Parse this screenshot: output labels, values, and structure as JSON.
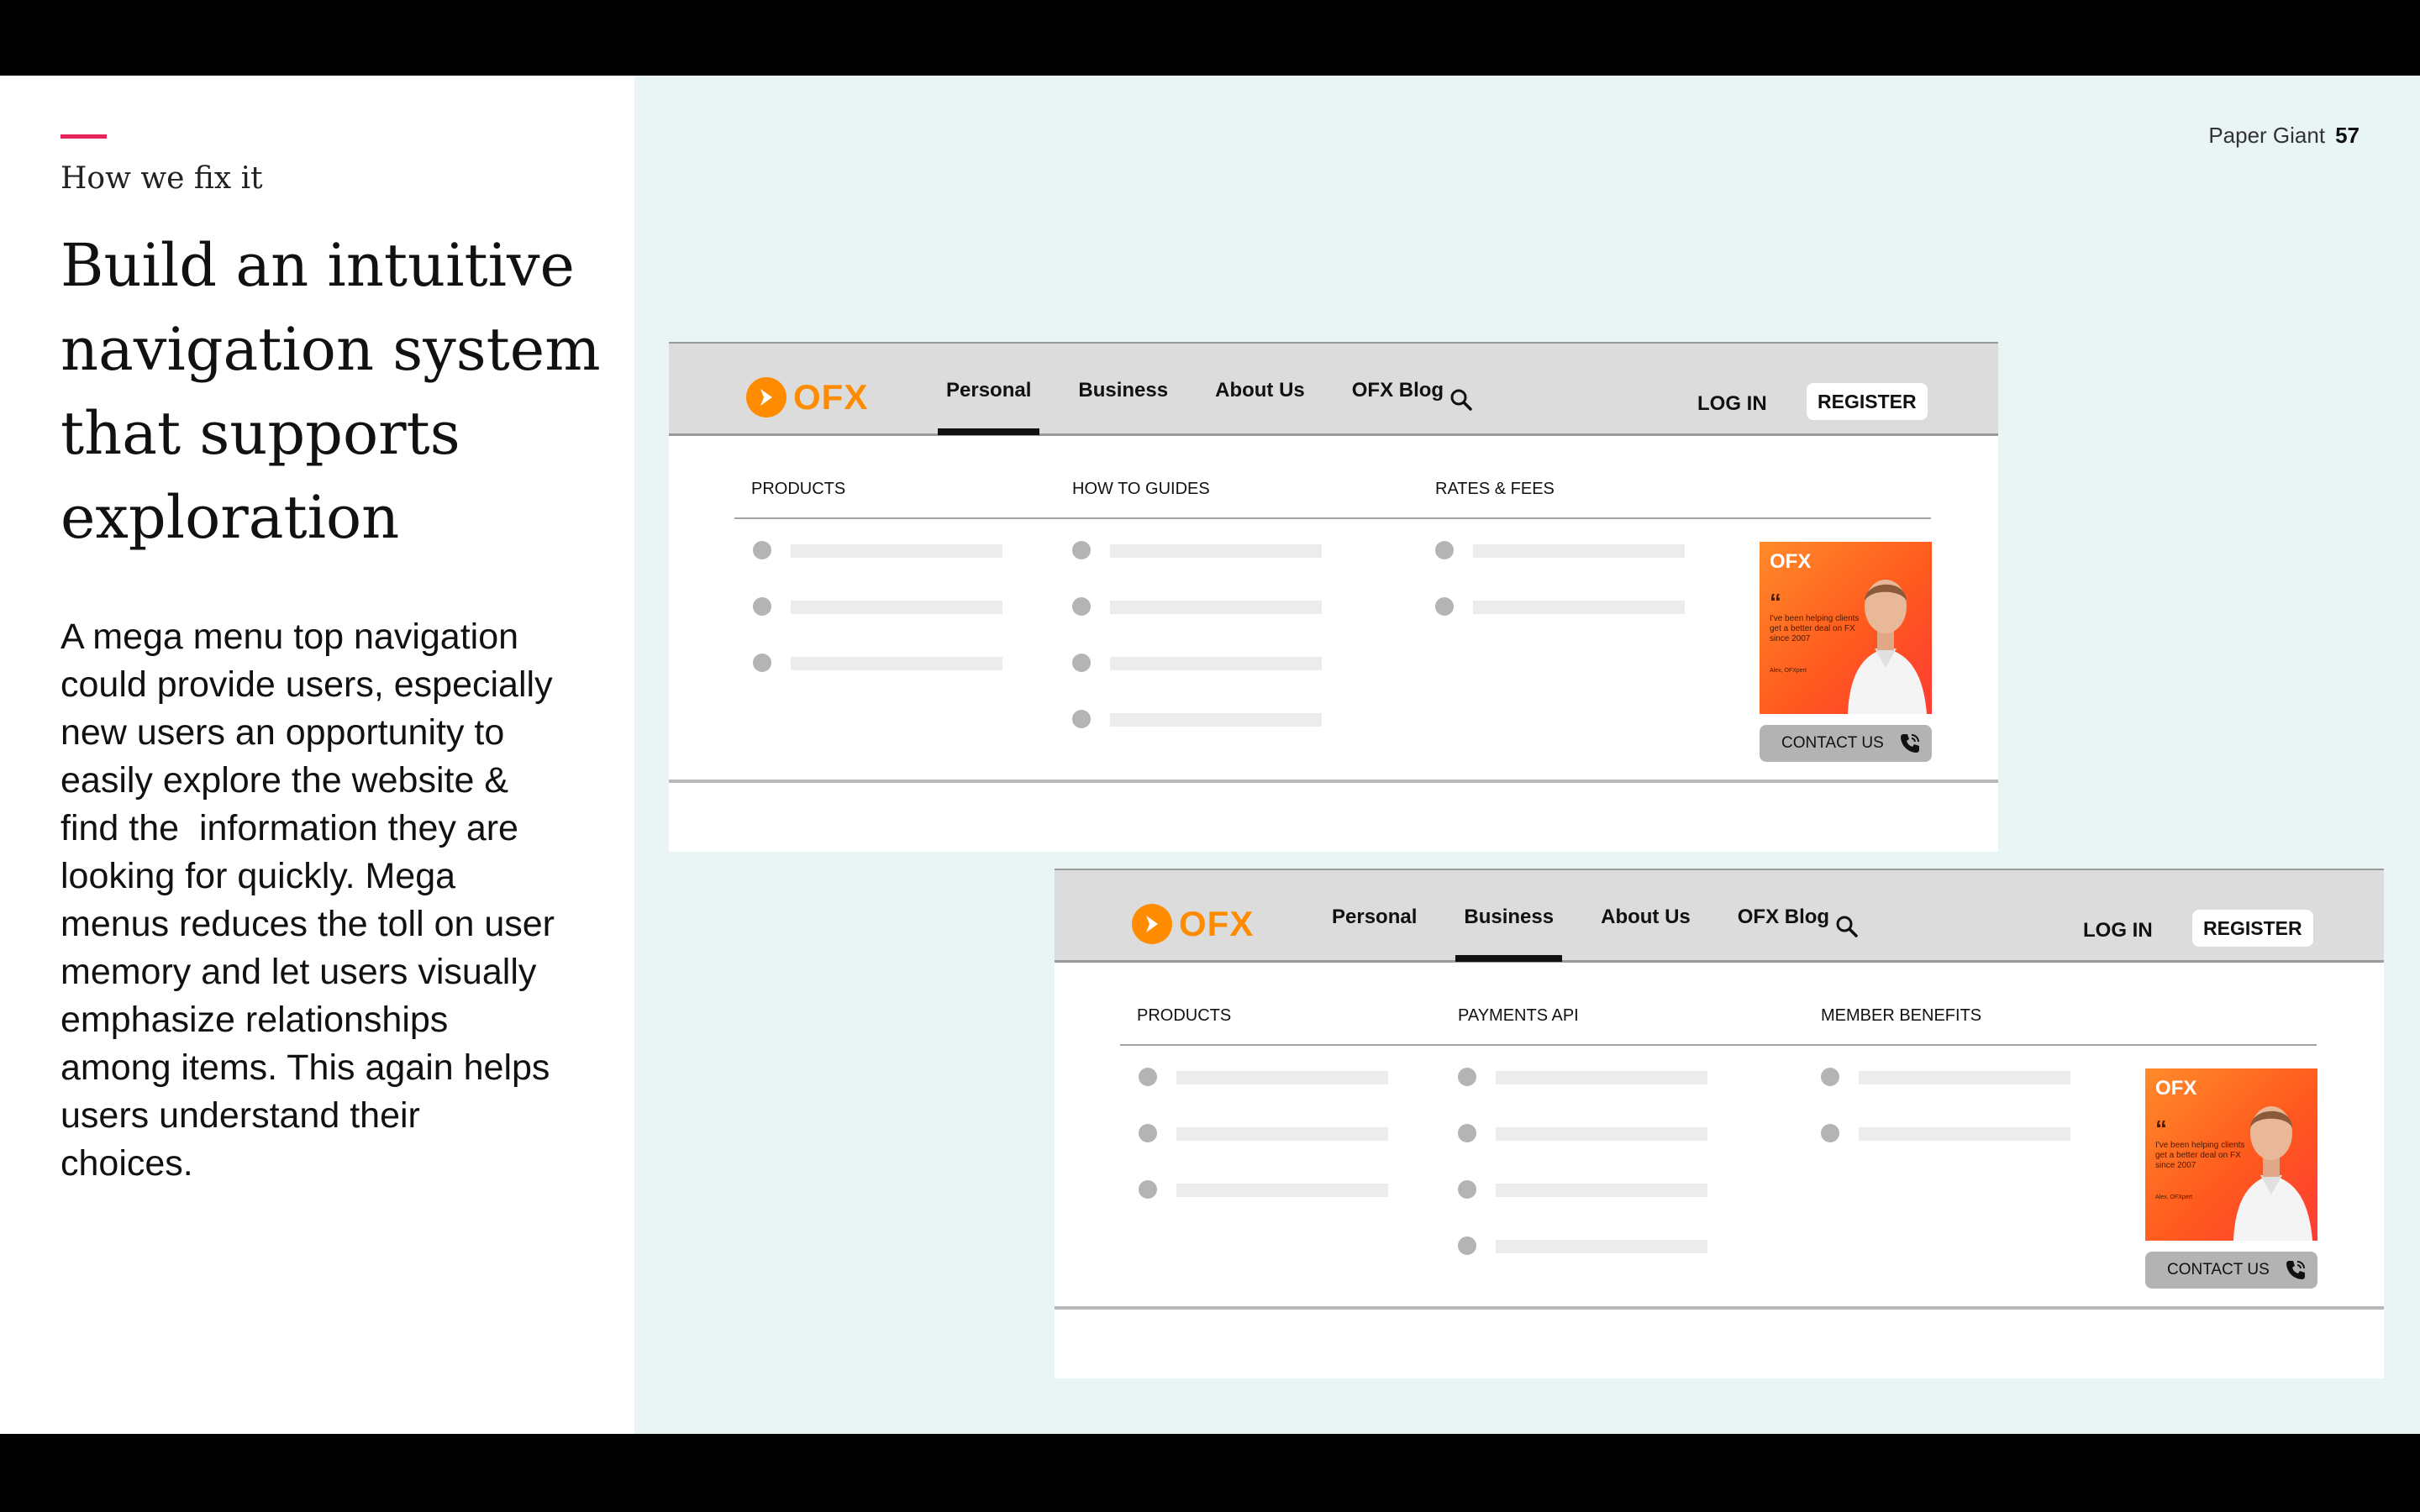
{
  "slide": {
    "eyebrow": "How we fix it",
    "headline_lines": [
      "Build an intuitive",
      "navigation system",
      "that supports",
      "exploration"
    ],
    "body_lines": [
      "A mega menu top navigation",
      "could provide users, especially",
      "new users an opportunity to",
      "easily explore the website &",
      "find the  information they are",
      "looking for quickly. Mega",
      "menus reduces the toll on user",
      "memory and let users visually",
      "emphasize relationships",
      "among items. This again helps",
      "users understand their",
      "choices."
    ],
    "brand": "Paper Giant",
    "page_number": "57"
  },
  "colors": {
    "accent": "#e8245c",
    "slide_background": "#e9f5f5",
    "ofx_orange": "#ff8c00"
  },
  "mockups": [
    {
      "logo": "OFX",
      "nav": [
        "Personal",
        "Business",
        "About Us",
        "OFX Blog"
      ],
      "active_nav": "Personal",
      "search_icon": "search-icon",
      "login": "LOG IN",
      "register": "REGISTER",
      "columns": [
        {
          "title": "PRODUCTS",
          "items": 3
        },
        {
          "title": "HOW TO GUIDES",
          "items": 4
        },
        {
          "title": "RATES & FEES",
          "items": 2
        }
      ],
      "promo": {
        "logo": "OFX",
        "quote_mark": "“",
        "text": "I've been helping clients get a better deal on FX since 2007",
        "caption": "Alex, OFXpert"
      },
      "contact": "CONTACT US"
    },
    {
      "logo": "OFX",
      "nav": [
        "Personal",
        "Business",
        "About Us",
        "OFX Blog"
      ],
      "active_nav": "Business",
      "search_icon": "search-icon",
      "login": "LOG IN",
      "register": "REGISTER",
      "columns": [
        {
          "title": "PRODUCTS",
          "items": 3
        },
        {
          "title": "PAYMENTS API",
          "items": 4
        },
        {
          "title": "MEMBER BENEFITS",
          "items": 2
        }
      ],
      "promo": {
        "logo": "OFX",
        "quote_mark": "“",
        "text": "I've been helping clients get a better deal on FX since 2007",
        "caption": "Alex, OFXpert"
      },
      "contact": "CONTACT US"
    }
  ]
}
